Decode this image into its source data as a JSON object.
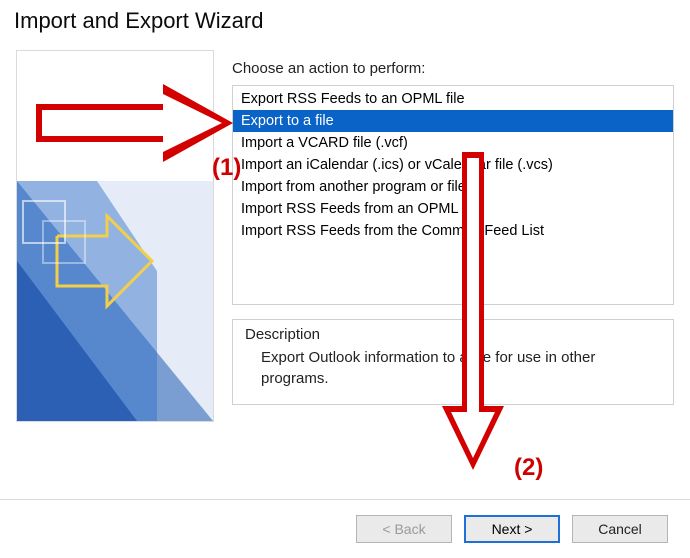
{
  "window": {
    "title": "Import and Export Wizard"
  },
  "prompt": "Choose an action to perform:",
  "actions": {
    "items": [
      "Export RSS Feeds to an OPML file",
      "Export to a file",
      "Import a VCARD file (.vcf)",
      "Import an iCalendar (.ics) or vCalendar file (.vcs)",
      "Import from another program or file",
      "Import RSS Feeds from an OPML file",
      "Import RSS Feeds from the Common Feed List"
    ],
    "selected_index": 1
  },
  "description": {
    "heading": "Description",
    "text": "Export Outlook information to a file for use in other programs."
  },
  "buttons": {
    "back": "< Back",
    "next": "Next >",
    "cancel": "Cancel"
  },
  "annotations": {
    "step1": "(1)",
    "step2": "(2)"
  }
}
